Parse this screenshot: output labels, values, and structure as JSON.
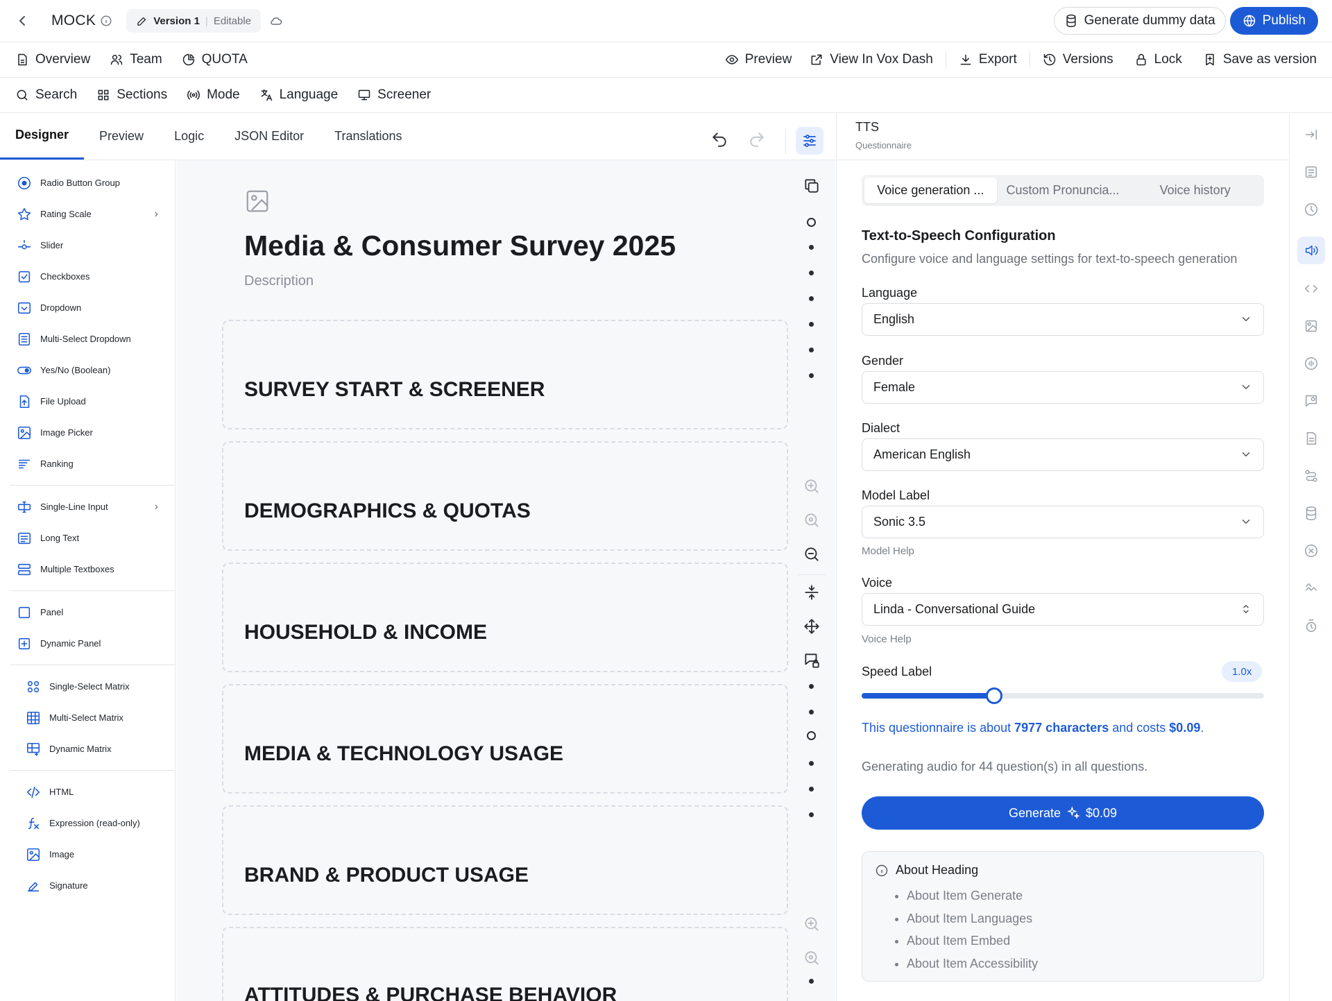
{
  "topbar": {
    "app_name": "MOCK",
    "version_label": "Version 1",
    "version_state": "Editable",
    "dummy_data_label": "Generate dummy data",
    "publish_label": "Publish"
  },
  "nav": {
    "left": [
      "Overview",
      "Team",
      "QUOTA"
    ],
    "right": [
      "Preview",
      "View In Vox Dash",
      "Export",
      "Versions",
      "Lock",
      "Save as version"
    ]
  },
  "toolbar": [
    "Search",
    "Sections",
    "Mode",
    "Language",
    "Screener"
  ],
  "editor_tabs": [
    "Designer",
    "Preview",
    "Logic",
    "JSON Editor",
    "Translations"
  ],
  "palette": {
    "group1": [
      "Radio Button Group",
      "Rating Scale",
      "Slider",
      "Checkboxes",
      "Dropdown",
      "Multi-Select Dropdown",
      "Yes/No (Boolean)",
      "File Upload",
      "Image Picker",
      "Ranking"
    ],
    "group2": [
      "Single-Line Input",
      "Long Text",
      "Multiple Textboxes"
    ],
    "group3": [
      "Panel",
      "Dynamic Panel"
    ],
    "group4": [
      "Single-Select Matrix",
      "Multi-Select Matrix",
      "Dynamic Matrix"
    ],
    "group5": [
      "HTML",
      "Expression (read-only)",
      "Image",
      "Signature"
    ]
  },
  "survey": {
    "title": "Media & Consumer Survey 2025",
    "description": "Description",
    "sections": [
      "SURVEY START & SCREENER",
      "DEMOGRAPHICS & QUOTAS",
      "HOUSEHOLD & INCOME",
      "MEDIA & TECHNOLOGY USAGE",
      "BRAND & PRODUCT USAGE",
      "ATTITUDES & PURCHASE BEHAVIOR"
    ]
  },
  "panel": {
    "title": "TTS",
    "subtitle": "Questionnaire",
    "tabs": [
      "Voice generation ...",
      "Custom Pronuncia...",
      "Voice history"
    ],
    "heading": "Text-to-Speech Configuration",
    "subheading": "Configure voice and language settings for text-to-speech generation",
    "language_label": "Language",
    "language_value": "English",
    "gender_label": "Gender",
    "gender_value": "Female",
    "dialect_label": "Dialect",
    "dialect_value": "American English",
    "model_label": "Model Label",
    "model_value": "Sonic 3.5",
    "model_help": "Model Help",
    "voice_label": "Voice",
    "voice_value": "Linda - Conversational Guide",
    "voice_help": "Voice Help",
    "speed_label": "Speed Label",
    "speed_value": "1.0x",
    "speed_fraction": 0.33,
    "cost_prefix": "This questionnaire is about ",
    "cost_chars": "7977 characters",
    "cost_mid": " and costs ",
    "cost_amount": "$0.09",
    "cost_suffix": ".",
    "generating_text": "Generating audio for 44 question(s) in all questions.",
    "generate_label": "Generate",
    "generate_cost": "$0.09",
    "about_heading": "About Heading",
    "about_items": [
      "About Item Generate",
      "About Item Languages",
      "About Item Embed",
      "About Item Accessibility"
    ]
  },
  "colors": {
    "accent": "#1d5bd6"
  }
}
